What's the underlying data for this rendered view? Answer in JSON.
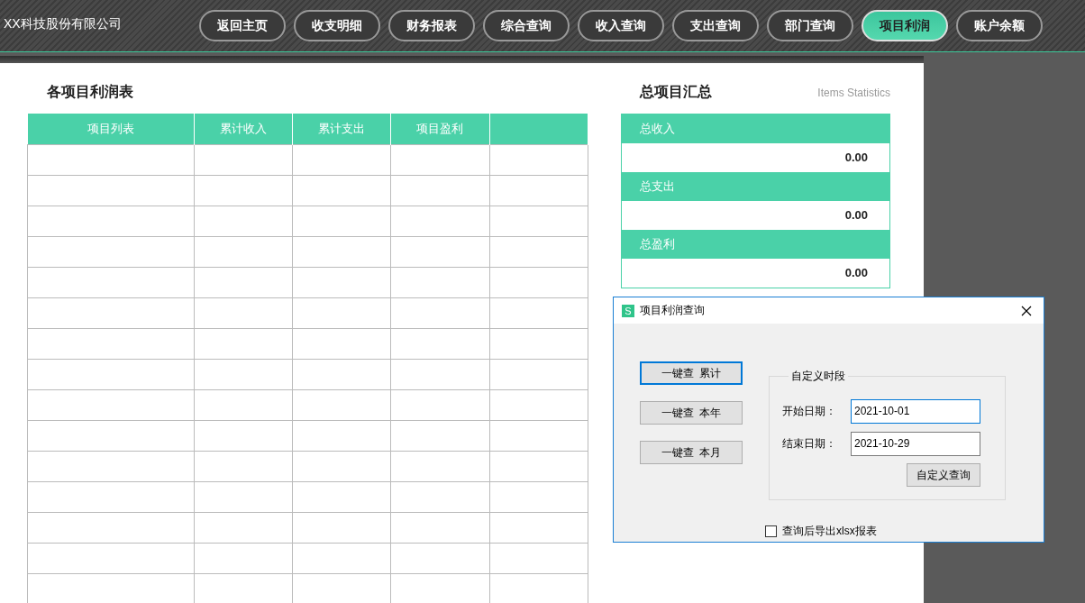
{
  "header": {
    "company": "XX科技股份有限公司",
    "nav": [
      {
        "label": "返回主页",
        "selected": false
      },
      {
        "label": "收支明细",
        "selected": false
      },
      {
        "label": "财务报表",
        "selected": false
      },
      {
        "label": "综合查询",
        "selected": false
      },
      {
        "label": "收入查询",
        "selected": false
      },
      {
        "label": "支出查询",
        "selected": false
      },
      {
        "label": "部门查询",
        "selected": false
      },
      {
        "label": "项目利润",
        "selected": true
      },
      {
        "label": "账户余额",
        "selected": false
      }
    ]
  },
  "profit_table": {
    "title": "各项目利润表",
    "columns": [
      "项目列表",
      "累计收入",
      "累计支出",
      "项目盈利"
    ]
  },
  "summary": {
    "title": "总项目汇总",
    "subtitle": "Items Statistics",
    "items": [
      {
        "label": "总收入",
        "value": "0.00"
      },
      {
        "label": "总支出",
        "value": "0.00"
      },
      {
        "label": "总盈利",
        "value": "0.00"
      }
    ]
  },
  "dialog": {
    "icon_text": "S",
    "title": "项目利润查询",
    "quick_buttons": [
      {
        "label": "一键查  累计",
        "focused": true
      },
      {
        "label": "一键查  本年",
        "focused": false
      },
      {
        "label": "一键查  本月",
        "focused": false
      }
    ],
    "group_title": "自定义时段",
    "fields": [
      {
        "label": "开始日期：",
        "value": "2021-10-01",
        "focused": true
      },
      {
        "label": "结束日期：",
        "value": "2021-10-29",
        "focused": false
      }
    ],
    "query_button": "自定义查询",
    "export_checkbox": {
      "label": "查询后导出xlsx报表",
      "checked": false
    }
  }
}
